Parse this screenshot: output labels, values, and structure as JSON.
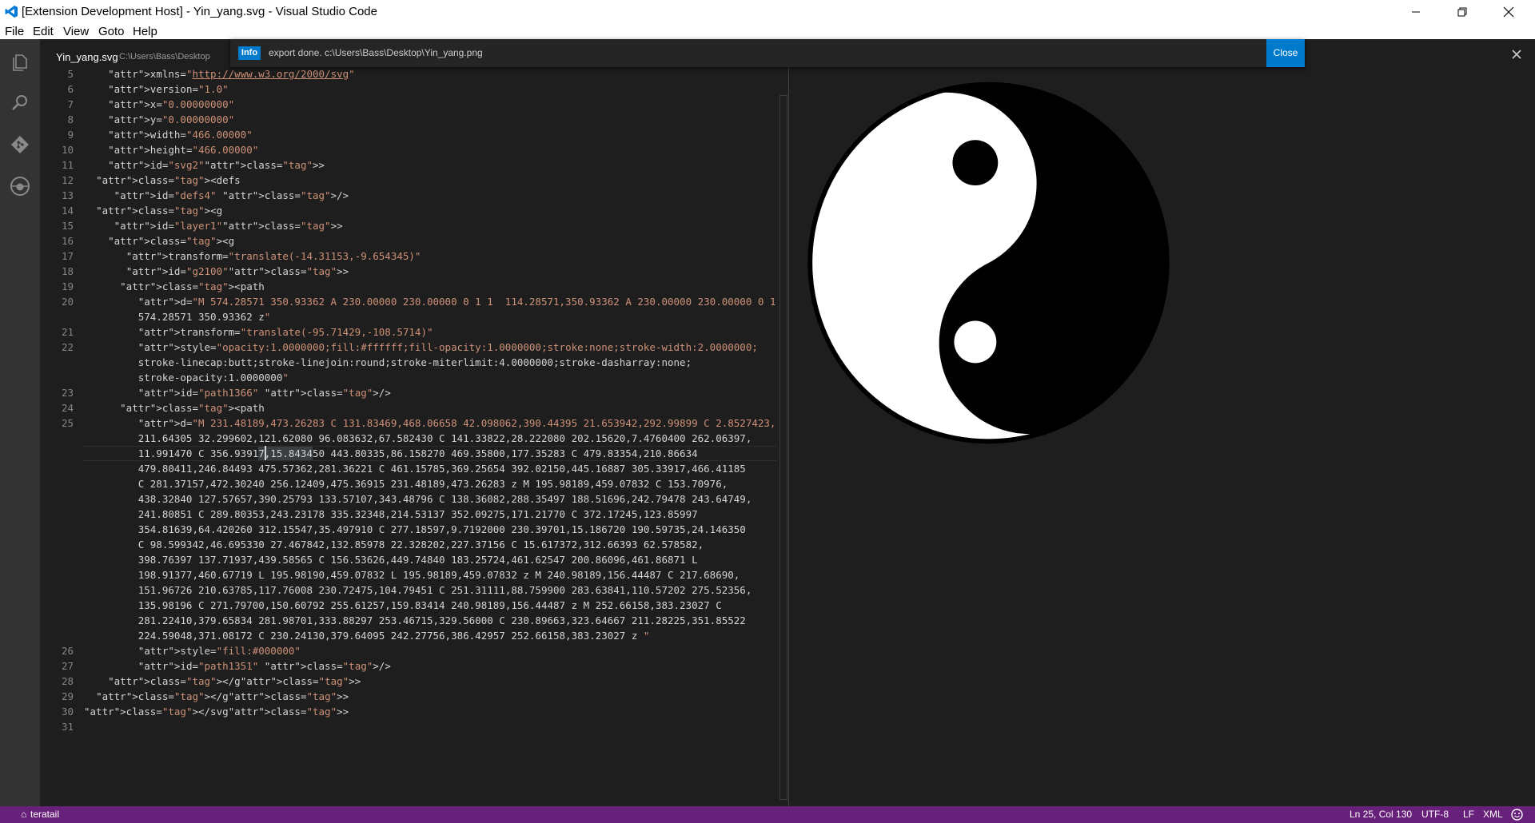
{
  "window": {
    "title": "[Extension Development Host] - Yin_yang.svg - Visual Studio Code",
    "minimize_icon": "minimize-icon",
    "maximize_icon": "restore-icon",
    "close_icon": "close-icon"
  },
  "menu": [
    "File",
    "Edit",
    "View",
    "Goto",
    "Help"
  ],
  "activity_bar": [
    "explorer-icon",
    "search-icon",
    "git-icon",
    "debug-icon"
  ],
  "tab": {
    "name": "Yin_yang.svg",
    "path": "C:\\Users\\Bass\\Desktop"
  },
  "notification": {
    "badge": "Info",
    "message": "export done. c:\\Users\\Bass\\Desktop\\Yin_yang.png",
    "close_label": "Close"
  },
  "code_lines": [
    {
      "n": "5",
      "text": "    xmlns=\"http://www.w3.org/2000/svg\""
    },
    {
      "n": "6",
      "text": "    version=\"1.0\""
    },
    {
      "n": "7",
      "text": "    x=\"0.00000000\""
    },
    {
      "n": "8",
      "text": "    y=\"0.00000000\""
    },
    {
      "n": "9",
      "text": "    width=\"466.00000\""
    },
    {
      "n": "10",
      "text": "    height=\"466.00000\""
    },
    {
      "n": "11",
      "text": "    id=\"svg2\">"
    },
    {
      "n": "12",
      "text": "  <defs"
    },
    {
      "n": "13",
      "text": "     id=\"defs4\" />"
    },
    {
      "n": "14",
      "text": "  <g"
    },
    {
      "n": "15",
      "text": "     id=\"layer1\">"
    },
    {
      "n": "16",
      "text": "    <g"
    },
    {
      "n": "17",
      "text": "       transform=\"translate(-14.31153,-9.654345)\""
    },
    {
      "n": "18",
      "text": "       id=\"g2100\">"
    },
    {
      "n": "19",
      "text": "      <path"
    },
    {
      "n": "20",
      "text": "         d=\"M 574.28571 350.93362 A 230.00000 230.00000 0 1 1  114.28571,350.93362 A 230.00000 230.00000 0 1 1"
    },
    {
      "n": "",
      "text": "         574.28571 350.93362 z\""
    },
    {
      "n": "21",
      "text": "         transform=\"translate(-95.71429,-108.5714)\""
    },
    {
      "n": "22",
      "text": "         style=\"opacity:1.0000000;fill:#ffffff;fill-opacity:1.0000000;stroke:none;stroke-width:2.0000000;"
    },
    {
      "n": "",
      "text": "         stroke-linecap:butt;stroke-linejoin:round;stroke-miterlimit:4.0000000;stroke-dasharray:none;"
    },
    {
      "n": "",
      "text": "         stroke-opacity:1.0000000\""
    },
    {
      "n": "23",
      "text": "         id=\"path1366\" />"
    },
    {
      "n": "24",
      "text": "      <path"
    },
    {
      "n": "25",
      "text": "         d=\"M 231.48189,473.26283 C 131.83469,468.06658 42.098062,390.44395 21.653942,292.99899 C 2.8527423,"
    },
    {
      "n": "",
      "text": "         211.64305 32.299602,121.62080 96.083632,67.582430 C 141.33822,28.222080 202.15620,7.4760400 262.06397,"
    },
    {
      "n": "",
      "text": "         11.991470 C 356.93917,15.843450 443.80335,86.158270 469.35800,177.35283 C 479.83354,210.86634"
    },
    {
      "n": "",
      "text": "         479.80411,246.84493 475.57362,281.36221 C 461.15785,369.25654 392.02150,445.16887 305.33917,466.41185"
    },
    {
      "n": "",
      "text": "         C 281.37157,472.30240 256.12409,475.36915 231.48189,473.26283 z M 195.98189,459.07832 C 153.70976,"
    },
    {
      "n": "",
      "text": "         438.32840 127.57657,390.25793 133.57107,343.48796 C 138.36082,288.35497 188.51696,242.79478 243.64749,"
    },
    {
      "n": "",
      "text": "         241.80851 C 289.80353,243.23178 335.32348,214.53137 352.09275,171.21770 C 372.17245,123.85997"
    },
    {
      "n": "",
      "text": "         354.81639,64.420260 312.15547,35.497910 C 277.18597,9.7192000 230.39701,15.186720 190.59735,24.146350"
    },
    {
      "n": "",
      "text": "         C 98.599342,46.695330 27.467842,132.85978 22.328202,227.37156 C 15.617372,312.66393 62.578582,"
    },
    {
      "n": "",
      "text": "         398.76397 137.71937,439.58565 C 156.53626,449.74840 183.25724,461.62547 200.86096,461.86871 L"
    },
    {
      "n": "",
      "text": "         198.91377,460.67719 L 195.98190,459.07832 L 195.98189,459.07832 z M 240.98189,156.44487 C 217.68690,"
    },
    {
      "n": "",
      "text": "         151.96726 210.63785,117.76008 230.72475,104.79451 C 251.31111,88.759900 283.63841,110.57202 275.52356,"
    },
    {
      "n": "",
      "text": "         135.98196 C 271.79700,150.60792 255.61257,159.83414 240.98189,156.44487 z M 252.66158,383.23027 C"
    },
    {
      "n": "",
      "text": "         281.22410,379.65834 281.98701,333.88297 253.46715,329.56000 C 230.89663,323.64667 211.28225,351.85522"
    },
    {
      "n": "",
      "text": "         224.59048,371.08172 C 230.24130,379.64095 242.27756,386.42957 252.66158,383.23027 z \""
    },
    {
      "n": "26",
      "text": "         style=\"fill:#000000\""
    },
    {
      "n": "27",
      "text": "         id=\"path1351\" />"
    },
    {
      "n": "28",
      "text": "    </g>"
    },
    {
      "n": "29",
      "text": "  </g>"
    },
    {
      "n": "30",
      "text": "</svg>"
    },
    {
      "n": "31",
      "text": ""
    }
  ],
  "preview": {
    "image": "yin-yang-symbol"
  },
  "status_bar": {
    "left": "teratail",
    "position": "Ln 25, Col 130",
    "encoding": "UTF-8",
    "eol": "LF",
    "language": "XML",
    "feedback_icon": "smiley-icon"
  },
  "colors": {
    "status_bar": "#68217a",
    "info_badge": "#007acc",
    "editor_bg": "#1e1e1e",
    "activity_bar": "#333333"
  }
}
